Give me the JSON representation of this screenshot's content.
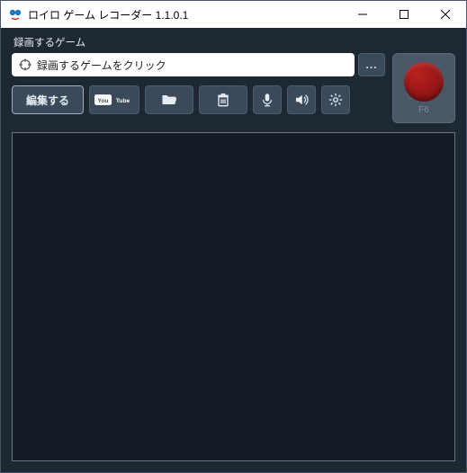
{
  "titlebar": {
    "title": "ロイロ ゲーム レコーダー 1.1.0.1"
  },
  "label_game_to_record": "録画するゲーム",
  "game_select": {
    "placeholder": "録画するゲームをクリック",
    "browse": "..."
  },
  "toolbar": {
    "edit": "編集する",
    "youtube": "YouTube",
    "folder": "folder-icon",
    "trash": "trash-icon",
    "mic": "mic-icon",
    "speaker": "speaker-icon",
    "settings": "gear-icon"
  },
  "record": {
    "hotkey": "F6"
  }
}
